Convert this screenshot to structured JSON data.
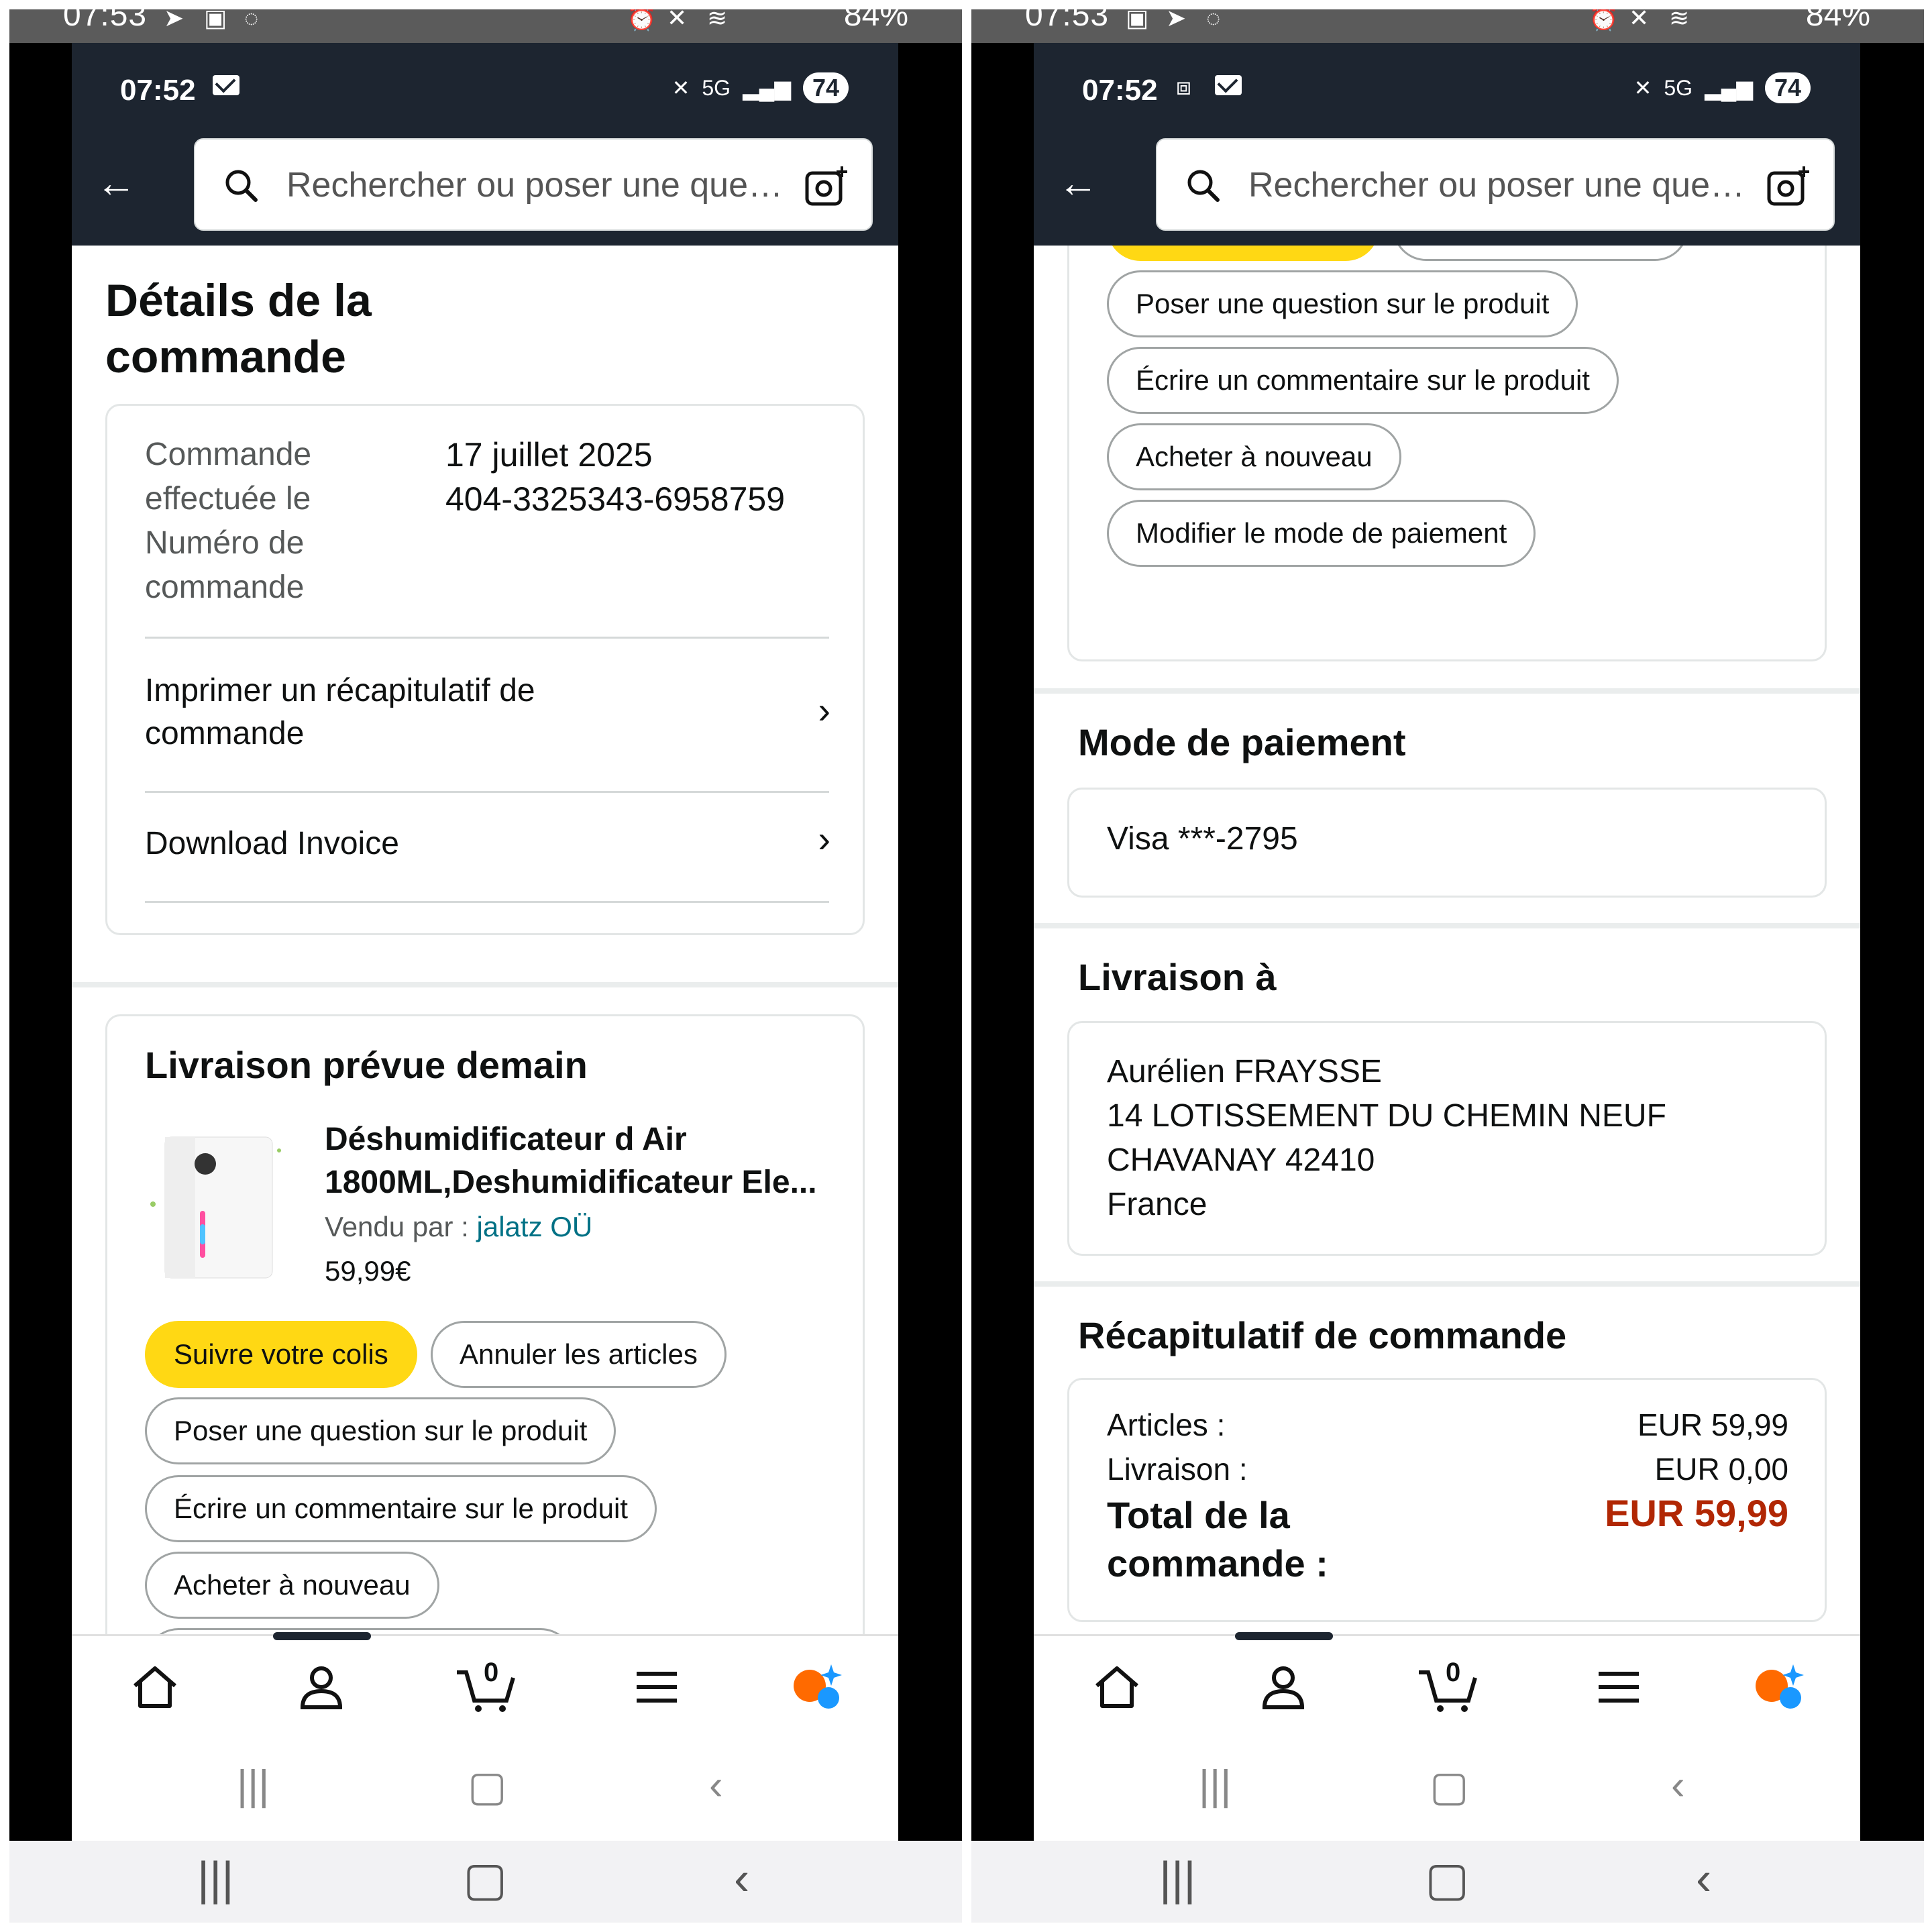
{
  "outer_status": {
    "time": "07:53",
    "battery": "84%"
  },
  "inner_status": {
    "time": "07:52",
    "battery": "74"
  },
  "search": {
    "placeholder": "Rechercher ou poser une que…"
  },
  "left": {
    "page_title": "Détails de la commande",
    "order_label_1": "Commande",
    "order_label_2": "effectuée le",
    "order_label_3": "Numéro de",
    "order_label_4": "commande",
    "order_date": "17 juillet 2025",
    "order_number": "404-3325343-6958759",
    "print_link": "Imprimer un récapitulatif de commande",
    "invoice_link": "Download Invoice",
    "delivery_title": "Livraison prévue demain",
    "product_name_1": "Déshumidificateur d Air",
    "product_name_2": "1800ML,Deshumidificateur Ele...",
    "sold_by_label": "Vendu par  :",
    "seller": "jalatz OÜ",
    "price": "59,99€",
    "btn_track": "Suivre votre colis",
    "btn_cancel": "Annuler les articles",
    "btn_question": "Poser une question sur le produit",
    "btn_review": "Écrire un commentaire sur le produit",
    "btn_rebuy": "Acheter à nouveau"
  },
  "right": {
    "btn_track": "Suivre votre colis",
    "btn_cancel": "Annuler les articles",
    "btn_question": "Poser une question sur le produit",
    "btn_review": "Écrire un commentaire sur le produit",
    "btn_rebuy": "Acheter à nouveau",
    "btn_payment": "Modifier le mode de paiement",
    "payment_title": "Mode de paiement",
    "payment_card": "Visa  ***-2795",
    "shipping_title": "Livraison à",
    "address_name": "Aurélien FRAYSSE",
    "address_line1": "14 LOTISSEMENT DU CHEMIN NEUF",
    "address_line2": "CHAVANAY 42410",
    "address_country": "France",
    "summary_title": "Récapitulatif de commande",
    "items_label": "Articles :",
    "items_value": "EUR 59,99",
    "shipping_label": "Livraison :",
    "shipping_value": "EUR 0,00",
    "total_label": "Total de la commande :",
    "total_value": "EUR 59,99"
  },
  "cart_count": "0",
  "colors": {
    "topbar": "#1d2530",
    "yellow_button": "#ffd814",
    "total_red": "#b12704",
    "link": "#007185"
  }
}
